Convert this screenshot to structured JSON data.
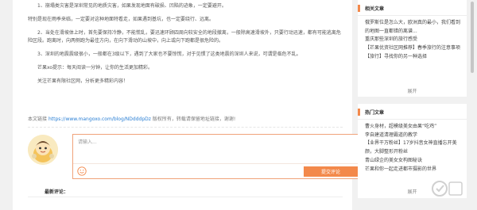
{
  "article": {
    "paragraphs": [
      "1、崩塌类灾害是深圳常见的地质灾害，如果发现地面有破损、凹陷的迹象，一定要避开。",
      "特别是现在雨季来临，一定要对这种地面特看走，如果遇到基坑，也一定要绕行、远离。",
      "2、当处在滑坡体上时，首先要保持冷静，不能慌乱，要迅速环顾四周向较安全的地段撤离，一般除高速滑坡外，只要行动迅速，都有可能逃离危险区段。跑离时，向两侧跑为最佳方向，在向下滑动的山坡中，向上或向下跑都是很危险的。",
      "3、深圳的地震震级很小，一般都在3级以下，遇到了大家也不要惊慌，对于见惯了这类地震的深圳人来说，可谓是临危不乱。",
      "芒果xo提示：每天阅读一分钟，让你的生活更加精彩。",
      "关注芒果有限社区网，分析更多精彩内容！"
    ],
    "source_prefix": "本文链接",
    "source_url": "https://www.mangoxo.com/blog/NDdddpDz",
    "source_suffix": "版权所有，转载请保留地址链接，谢谢!"
  },
  "comment": {
    "placeholder": "请输入...",
    "submit_label": "提交评论",
    "latest_label": "最新评论："
  },
  "sidebar": {
    "related_title": "相关文章",
    "related_items": [
      "俄罗斯位是怎么大，欧洲真的最小，我们看到的地图一直都错的离谱...",
      "重庆那些深圳的旅行感受",
      "【芒果优资社区网推荐】春季旅行的注意事项",
      "【旅行】寻找你的另一种选择"
    ],
    "related_expand": "展开",
    "hot_title": "热门文章",
    "hot_items": [
      "曹火身材，超模级美女由果“吃鸡”",
      "李自建道清理霸道的教学",
      "【业界干万粉丝】17岁抖音女神直播忘开美颜，大脚整形开粉丝",
      "青山绿企的美女女构图秘诀",
      "芒果和你一起走进都市摄影的世界"
    ],
    "hot_expand": "展开"
  },
  "icons": {
    "smiley": "smiley-icon",
    "avatar": "cartoon-avatar",
    "watermark": "watermark-logo"
  },
  "colors": {
    "accent": "#f3894b",
    "link": "#2a7fd4"
  }
}
